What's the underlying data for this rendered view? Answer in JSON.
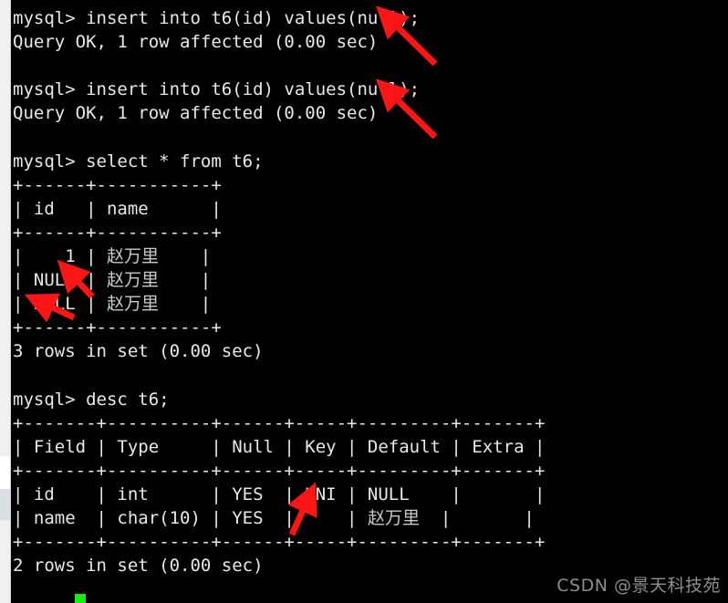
{
  "window": {
    "type": "terminal",
    "background_color": "#000000",
    "text_color": "#e8e8e8",
    "cjk_text_color": "#c9c9c9",
    "annotation_color": "#fb1515",
    "cursor_color": "#16ec16"
  },
  "terminal": {
    "lines": [
      "mysql> insert into t6(id) values(null);",
      "Query OK, 1 row affected (0.00 sec)",
      "",
      "mysql> insert into t6(id) values(null);",
      "Query OK, 1 row affected (0.00 sec)",
      "",
      "mysql> select * from t6;",
      "+------+-----------+",
      "| id   | name      |",
      "+------+-----------+",
      "|    1 | 赵万里    |",
      "| NULL | 赵万里    |",
      "| NULL | 赵万里    |",
      "+------+-----------+",
      "3 rows in set (0.00 sec)",
      "",
      "mysql> desc t6;",
      "+-------+----------+------+-----+---------+-------+",
      "| Field | Type     | Null | Key | Default | Extra |",
      "+-------+----------+------+-----+---------+-------+",
      "| id    | int      | YES  | UNI | NULL    |       |",
      "| name  | char(10) | YES  |     | 赵万里  |       |",
      "+-------+----------+------+-----+---------+-------+",
      "2 rows in set (0.00 sec)"
    ],
    "commands": [
      {
        "prompt": "mysql>",
        "statement": "insert into t6(id) values(null);"
      },
      {
        "prompt": "mysql>",
        "statement": "insert into t6(id) values(null);"
      },
      {
        "prompt": "mysql>",
        "statement": "select * from t6;"
      },
      {
        "prompt": "mysql>",
        "statement": "desc t6;"
      }
    ],
    "results": [
      "Query OK, 1 row affected (0.00 sec)",
      "Query OK, 1 row affected (0.00 sec)",
      "3 rows in set (0.00 sec)",
      "2 rows in set (0.00 sec)"
    ],
    "select_table": {
      "headers": [
        "id",
        "name"
      ],
      "rows": [
        [
          "1",
          "赵万里"
        ],
        [
          "NULL",
          "赵万里"
        ],
        [
          "NULL",
          "赵万里"
        ]
      ],
      "footer": "3 rows in set (0.00 sec)"
    },
    "desc_table": {
      "headers": [
        "Field",
        "Type",
        "Null",
        "Key",
        "Default",
        "Extra"
      ],
      "rows": [
        [
          "id",
          "int",
          "YES",
          "UNI",
          "NULL",
          ""
        ],
        [
          "name",
          "char(10)",
          "YES",
          "",
          "赵万里",
          ""
        ]
      ],
      "footer": "2 rows in set (0.00 sec)"
    }
  },
  "annotations": [
    {
      "name": "arrow-insert-1",
      "points_at": "values(null); on first insert"
    },
    {
      "name": "arrow-insert-2",
      "points_at": "values(null); on second insert"
    },
    {
      "name": "arrow-null-row-2",
      "points_at": "NULL in id column row 2"
    },
    {
      "name": "arrow-null-row-3",
      "points_at": "NULL in id column row 3"
    },
    {
      "name": "arrow-uni-key",
      "points_at": "UNI in Key column"
    }
  ],
  "watermark": {
    "text": "CSDN @景天科技苑"
  }
}
